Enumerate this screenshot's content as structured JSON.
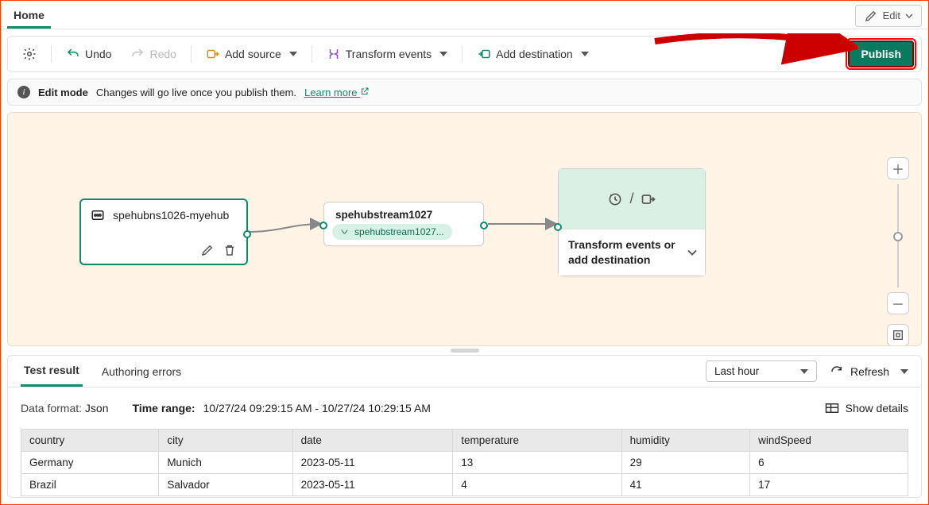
{
  "tabs": {
    "home": "Home",
    "edit_button": "Edit"
  },
  "toolbar": {
    "undo": "Undo",
    "redo": "Redo",
    "add_source": "Add source",
    "transform": "Transform events",
    "add_destination": "Add destination",
    "publish": "Publish"
  },
  "editbar": {
    "title": "Edit mode",
    "text": "Changes will go live once you publish them.",
    "link": "Learn more"
  },
  "nodes": {
    "source": {
      "label": "spehubns1026-myehub"
    },
    "stream": {
      "title": "spehubstream1027",
      "pill": "spehubstream1027..."
    },
    "dest": {
      "label": "Transform events or add destination"
    }
  },
  "results": {
    "tabs": {
      "test": "Test result",
      "errors": "Authoring errors"
    },
    "timerange_select": "Last hour",
    "refresh": "Refresh",
    "data_format_label": "Data format:",
    "data_format_value": "Json",
    "timerange_label": "Time range:",
    "timerange_value": "10/27/24 09:29:15 AM - 10/27/24 10:29:15 AM",
    "show_details": "Show details",
    "columns": [
      "country",
      "city",
      "date",
      "temperature",
      "humidity",
      "windSpeed"
    ]
  },
  "chart_data": {
    "type": "table",
    "columns": [
      "country",
      "city",
      "date",
      "temperature",
      "humidity",
      "windSpeed"
    ],
    "rows": [
      {
        "country": "Germany",
        "city": "Munich",
        "date": "2023-05-11",
        "temperature": "13",
        "humidity": "29",
        "windSpeed": "6"
      },
      {
        "country": "Brazil",
        "city": "Salvador",
        "date": "2023-05-11",
        "temperature": "4",
        "humidity": "41",
        "windSpeed": "17"
      }
    ]
  }
}
